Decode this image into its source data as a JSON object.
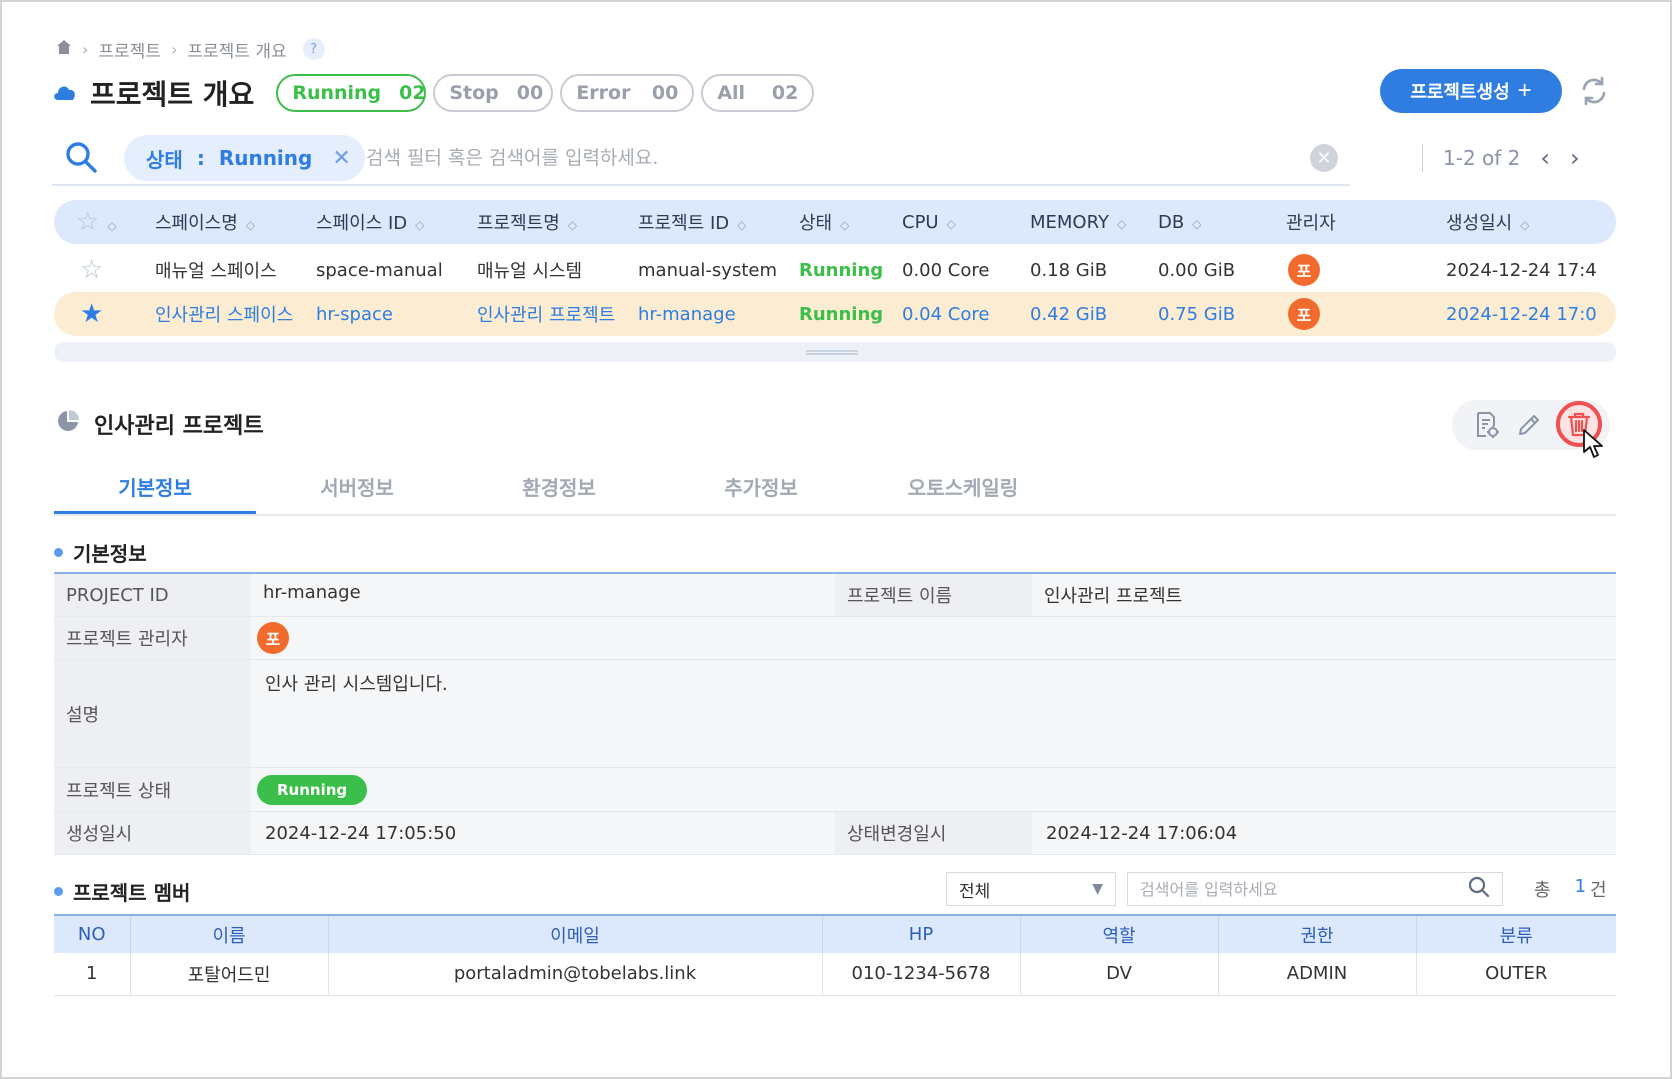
{
  "breadcrumb": {
    "items": [
      "프로젝트",
      "프로젝트 개요"
    ],
    "help": "?"
  },
  "header": {
    "title": "프로젝트 개요",
    "status_pills": [
      {
        "label": "Running",
        "count": "02"
      },
      {
        "label": "Stop",
        "count": "00"
      },
      {
        "label": "Error",
        "count": "00"
      },
      {
        "label": "All",
        "count": "02"
      }
    ],
    "create_button": "프로젝트생성",
    "create_plus": "+"
  },
  "search": {
    "filter_key": "상태",
    "filter_sep": ":",
    "filter_value": "Running",
    "placeholder": "검색 필터 혹은 검색어를 입력하세요.",
    "pagination": "1-2 of 2"
  },
  "projects_table": {
    "columns": [
      "스페이스명",
      "스페이스 ID",
      "프로젝트명",
      "프로젝트 ID",
      "상태",
      "CPU",
      "MEMORY",
      "DB",
      "관리자",
      "생성일시"
    ],
    "rows": [
      {
        "space_name": "매뉴얼 스페이스",
        "space_id": "space-manual",
        "project_name": "매뉴얼 시스템",
        "project_id": "manual-system",
        "status": "Running",
        "cpu": "0.00 Core",
        "memory": "0.18 GiB",
        "db": "0.00 GiB",
        "admin": "포",
        "created": "2024-12-24 17:4",
        "starred": false
      },
      {
        "space_name": "인사관리 스페이스",
        "space_id": "hr-space",
        "project_name": "인사관리 프로젝트",
        "project_id": "hr-manage",
        "status": "Running",
        "cpu": "0.04 Core",
        "memory": "0.42 GiB",
        "db": "0.75 GiB",
        "admin": "포",
        "created": "2024-12-24 17:0",
        "starred": true
      }
    ]
  },
  "detail": {
    "title": "인사관리 프로젝트",
    "tabs": [
      "기본정보",
      "서버정보",
      "환경정보",
      "추가정보",
      "오토스케일링"
    ],
    "basic_section": "기본정보",
    "fields": {
      "project_id_label": "PROJECT ID",
      "project_id": "hr-manage",
      "project_name_label": "프로젝트 이름",
      "project_name": "인사관리 프로젝트",
      "manager_label": "프로젝트 관리자",
      "manager_avatar": "포",
      "desc_label": "설명",
      "desc": "인사 관리 시스템입니다.",
      "status_label": "프로젝트 상태",
      "status": "Running",
      "created_label": "생성일시",
      "created": "2024-12-24 17:05:50",
      "changed_label": "상태변경일시",
      "changed": "2024-12-24 17:06:04"
    }
  },
  "members": {
    "title": "프로젝트 멤버",
    "filter_value": "전체",
    "search_placeholder": "검색어를 입력하세요",
    "total_label": "총",
    "total_count": "1",
    "total_unit": "건",
    "columns": [
      "NO",
      "이름",
      "이메일",
      "HP",
      "역할",
      "권한",
      "분류"
    ],
    "rows": [
      {
        "no": "1",
        "name": "포탈어드민",
        "email": "portaladmin@tobelabs.link",
        "hp": "010-1234-5678",
        "role": "DV",
        "auth": "ADMIN",
        "type": "OUTER"
      }
    ]
  },
  "colors": {
    "primary": "#2f7de0",
    "running": "#3cbf4a",
    "avatar": "#f26b2e",
    "danger": "#ef5050",
    "selected_row": "#fbecd2"
  }
}
